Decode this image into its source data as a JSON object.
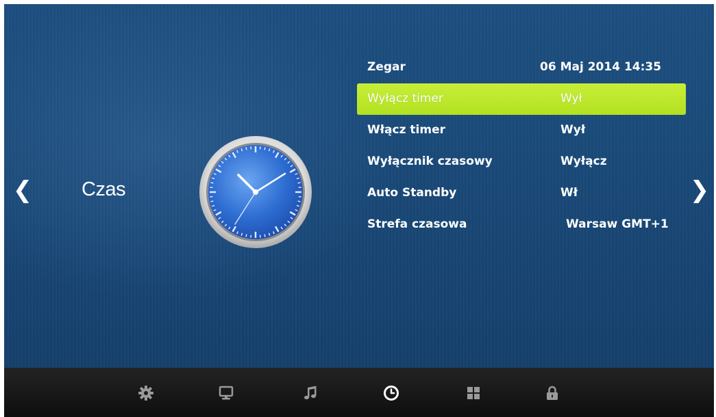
{
  "section": {
    "title": "Czas"
  },
  "nav": {
    "prev_glyph": "❮",
    "next_glyph": "❯"
  },
  "menu": {
    "items": [
      {
        "label": "Zegar",
        "value": "06 Maj 2014 14:35"
      },
      {
        "label": "Wyłącz timer",
        "value": "Wył"
      },
      {
        "label": "Włącz timer",
        "value": "Wył"
      },
      {
        "label": "Wyłącznik czasowy",
        "value": "Wyłącz"
      },
      {
        "label": "Auto Standby",
        "value": "Wł"
      },
      {
        "label": "Strefa czasowa",
        "value": "Warsaw GMT+1"
      }
    ],
    "selected_index": 1
  },
  "bottom_icons": [
    "settings-icon",
    "screen-icon",
    "music-icon",
    "clock-icon",
    "apps-icon",
    "lock-icon"
  ],
  "colors": {
    "background": "#1a4a79",
    "highlight": "#b9e52a",
    "bottom_bar": "#151515",
    "icon_inactive": "#9a9a9a",
    "icon_active": "#ffffff"
  }
}
